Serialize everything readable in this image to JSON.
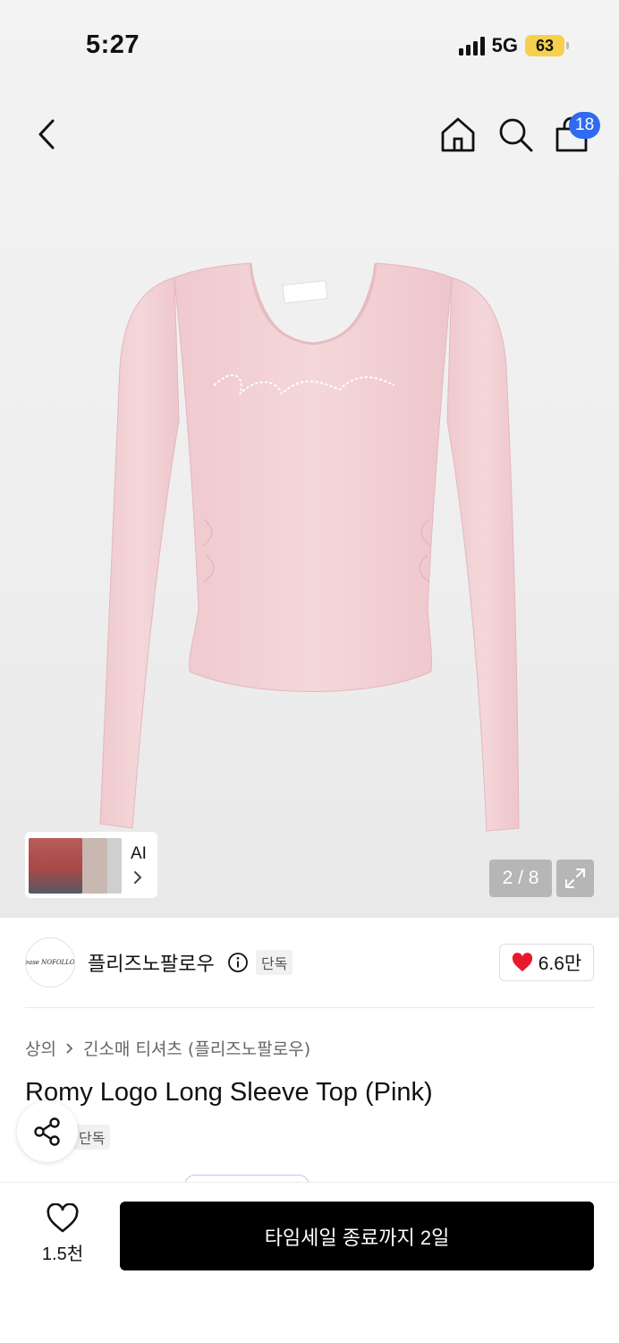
{
  "status_bar": {
    "time": "5:27",
    "network": "5G",
    "battery": "63"
  },
  "nav": {
    "cart_count": "18"
  },
  "gallery": {
    "ai_label": "AI",
    "pager": "2 / 8"
  },
  "brand": {
    "logo_text": "please NOFOLLOW",
    "name": "플리즈노팔로우",
    "exclusive_badge": "단독",
    "likes": "6.6만"
  },
  "product": {
    "breadcrumb": [
      "상의",
      "긴소매 티셔츠 (플리즈노팔로우)"
    ],
    "title": "Romy Logo Long Sleeve Top (Pink)",
    "exclusive_badge": "단독"
  },
  "bottom_bar": {
    "wish_count": "1.5천",
    "cta_label": "타임세일 종료까지 2일"
  },
  "colors": {
    "accent_blue": "#2f6bf0",
    "heart_red": "#e8192c",
    "battery_yellow": "#f6d04d",
    "shirt_pink": "#f2d0d4"
  }
}
